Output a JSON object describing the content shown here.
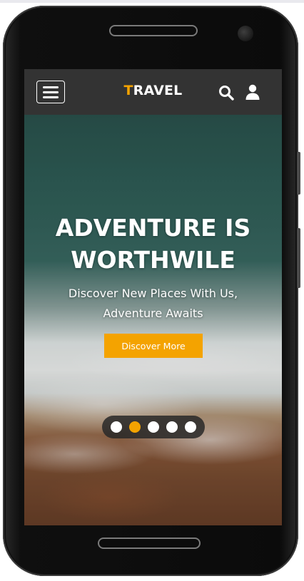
{
  "navbar": {
    "brand_first": "T",
    "brand_rest": "RAVEL",
    "menu_icon": "hamburger-menu-icon",
    "search_icon": "search-icon",
    "user_icon": "user-icon"
  },
  "hero": {
    "title_line1": "ADVENTURE IS",
    "title_line2": "WORTHWILE",
    "subtitle_line1": "Discover New Places With Us,",
    "subtitle_line2": "Adventure Awaits",
    "cta_label": "Discover More"
  },
  "carousel": {
    "slide_count": 5,
    "active_slide": 2
  },
  "colors": {
    "accent": "#f4a300",
    "navbar_bg": "#333333",
    "text": "#ffffff"
  }
}
